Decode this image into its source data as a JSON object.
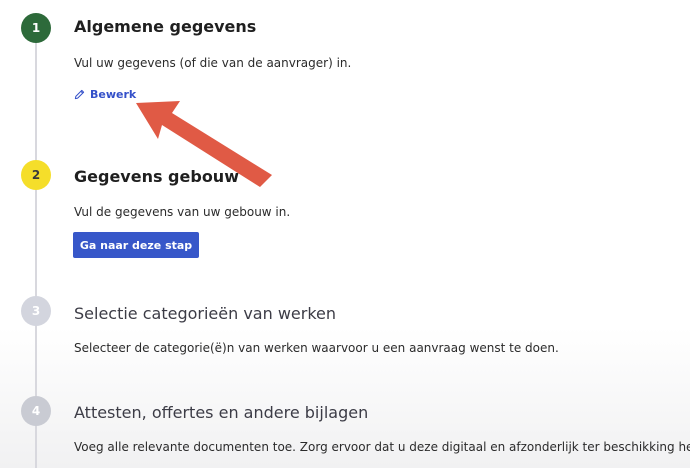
{
  "steps": [
    {
      "number": "1",
      "title": "Algemene gegevens",
      "description": "Vul uw gegevens (of die van de aanvrager) in.",
      "edit_label": "Bewerk",
      "status_color": "#2d6a3a"
    },
    {
      "number": "2",
      "title": "Gegevens gebouw",
      "description": "Vul de gegevens van uw gebouw in.",
      "button_label": "Ga naar deze stap",
      "status_color": "#f5de2a"
    },
    {
      "number": "3",
      "title": "Selectie categorieën van werken",
      "description": "Selecteer de categorie(ë)n van werken waarvoor u een aanvraag wenst te doen.",
      "status_color": "#d3d5de"
    },
    {
      "number": "4",
      "title": "Attesten, offertes en andere bijlagen",
      "description": "Voeg alle relevante documenten toe. Zorg ervoor dat u deze digitaal en afzonderlijk ter beschikking hebt.",
      "status_color": "#c9cbd3"
    }
  ],
  "colors": {
    "accent": "#3757c9",
    "annotation_arrow": "#e05a45"
  },
  "icons": {
    "edit": "pencil-icon",
    "annotation": "arrow-annotation-icon"
  }
}
